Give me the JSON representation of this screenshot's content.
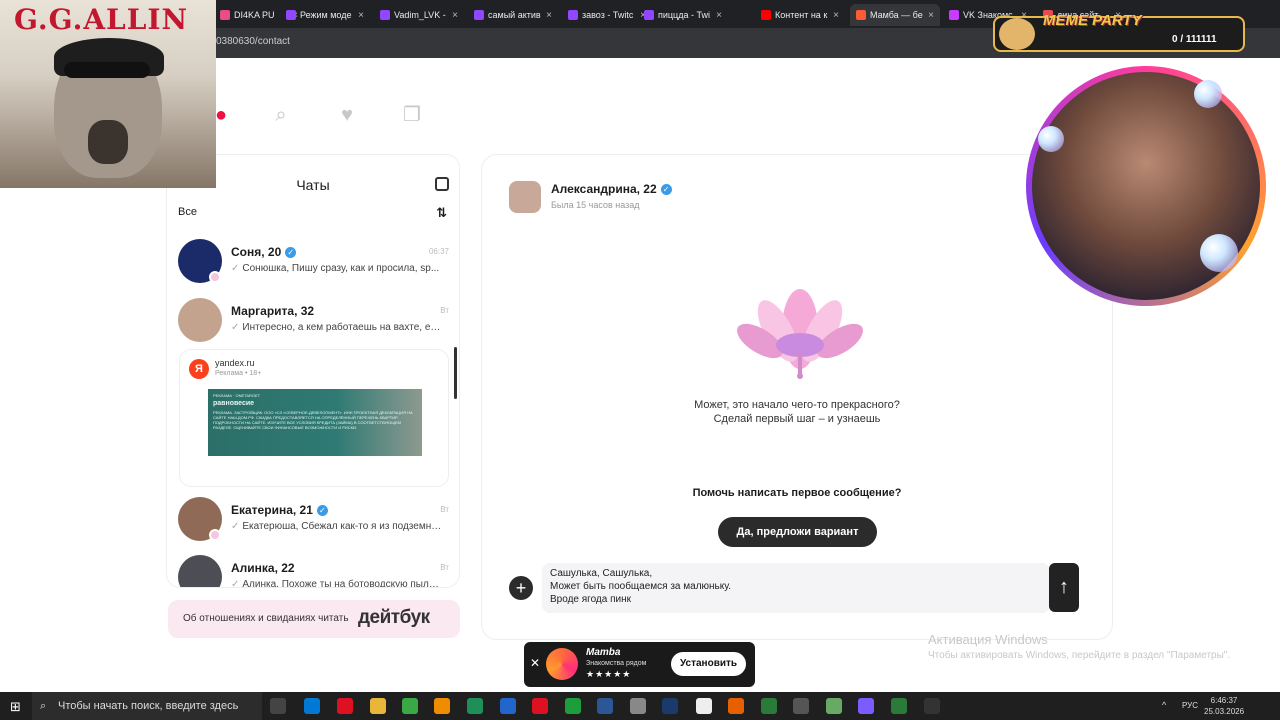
{
  "browser": {
    "tabs": [
      {
        "label": "DI4KA PU",
        "color": "#ea4c89",
        "active": false
      },
      {
        "label": "Режим моде",
        "color": "#9146ff",
        "active": false
      },
      {
        "label": "Vadim_LVK -",
        "color": "#9146ff",
        "active": false
      },
      {
        "label": "самый актив",
        "color": "#9146ff",
        "active": false
      },
      {
        "label": "завоз - Twitc",
        "color": "#9146ff",
        "active": false
      },
      {
        "label": "пиццда - Twi",
        "color": "#9146ff",
        "active": false
      },
      {
        "label": "Контент на к",
        "color": "#ff0000",
        "active": false
      },
      {
        "label": "Мамба — бе",
        "color": "#ff5a36",
        "active": true
      },
      {
        "label": "VK Знакомс",
        "color": "#c83cff",
        "active": false
      },
      {
        "label": "дина сайт",
        "color": "#e84b4b",
        "active": false
      }
    ],
    "url": "0380630/contact"
  },
  "nav_icons": [
    "profile-icon",
    "search-icon",
    "likes-icon",
    "chats-icon"
  ],
  "sidebar": {
    "title": "Чаты",
    "filter": "Все",
    "chats": [
      {
        "name": "Соня, 20",
        "verified": true,
        "time": "06:37",
        "message": "Сонюшка, Пишу сразу, как и просила, sp..."
      },
      {
        "name": "Маргарита, 32",
        "verified": false,
        "time": "Вт",
        "message": "Интересно, а кем работаешь на вахте, есл..."
      },
      {
        "name": "Екатерина, 21",
        "verified": true,
        "time": "Вт",
        "message": "Екатерюша, Сбежал как-то я из подземной ..."
      },
      {
        "name": "Алинка, 22",
        "verified": false,
        "time": "Вт",
        "message": "Алинка, Похоже ты на ботоводскую пылинк..."
      }
    ],
    "ad": {
      "domain": "yandex.ru",
      "label": "Реклама • 18+",
      "banner_title": "равновесие",
      "banner_top": "РЕКЛАМА · ONETARGET",
      "banner_text": "РЕКЛАМА. ЗАСТРОЙЩИК: ООО «СЗ «СЕВЕРНОЕ-ДЕВЕЛОПМЕНТ». ИНН ПРОЕКТНАЯ ДЕКЛАРАЦИЯ НА САЙТЕ НАШ.ДОМ.РФ. СКИДКА ПРЕДОСТАВЛЯЕТСЯ НА ОПРЕДЕЛЁННЫЙ ПЕРЕЧЕНЬ КВАРТИР. ПОДРОБНОСТИ НА САЙТЕ. ИЗУЧИТЕ ВСЕ УСЛОВИЯ КРЕДИТА (ЗАЙМА) В СООТВЕТСТВУЮЩЕМ РАЗДЕЛЕ. ОЦЕНИВАЙТЕ СВОИ ФИНАНСОВЫЕ ВОЗМОЖНОСТИ И РИСКИ."
    }
  },
  "promo": {
    "text": "Об отношениях и свиданиях читать",
    "logo": "дейтбук"
  },
  "chat": {
    "contact_name": "Александрина, 22",
    "status": "Была 15 часов назад",
    "empty_line1": "Может, это начало чего-то прекрасного?",
    "empty_line2": "Сделай первый шаг – и узнаешь",
    "help_question": "Помочь написать первое сообщение?",
    "suggest_button": "Да, предложи вариант",
    "draft_lines": [
      "Сашулька, Сашулька,",
      "Может быть пообщаемся за малюньку.",
      "Вроде ягода пинк"
    ]
  },
  "overlays": {
    "webcam_title": "G.G.ALLIN",
    "meme_tag": "MEME PARTY",
    "meme_count": "0 / 111111"
  },
  "windows": {
    "activate_title": "Активация Windows",
    "activate_sub": "Чтобы активировать Windows, перейдите в раздел \"Параметры\".",
    "search_placeholder": "Чтобы начать поиск, введите здесь запрос",
    "lang": "РУС",
    "time": "6:46:37",
    "date": "25.03.2026"
  },
  "toast": {
    "app": "Mamba",
    "description": "Знакомства рядом",
    "stars": "★★★★★",
    "install": "Установить"
  }
}
